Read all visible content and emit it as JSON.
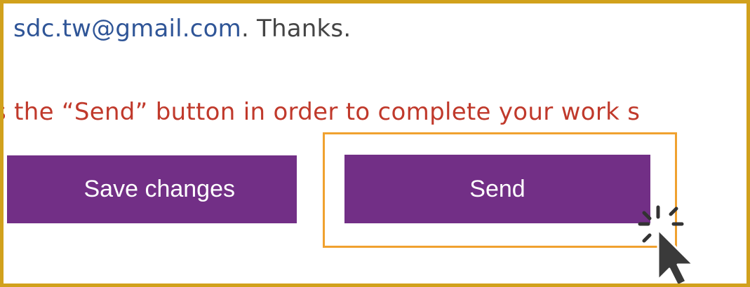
{
  "email_line": {
    "email": "sdc.tw@gmail.com",
    "thanks": ". Thanks."
  },
  "instruction": {
    "text": "s the “Send” button in order to complete your work s"
  },
  "buttons": {
    "save_label": "Save changes",
    "send_label": "Send"
  },
  "colors": {
    "frame": "#d1a11c",
    "button": "#722f86",
    "highlight": "#f0a12f",
    "instruction": "#c0392b",
    "email": "#2f5597"
  },
  "icons": {
    "cursor": "click-pointer-icon"
  }
}
